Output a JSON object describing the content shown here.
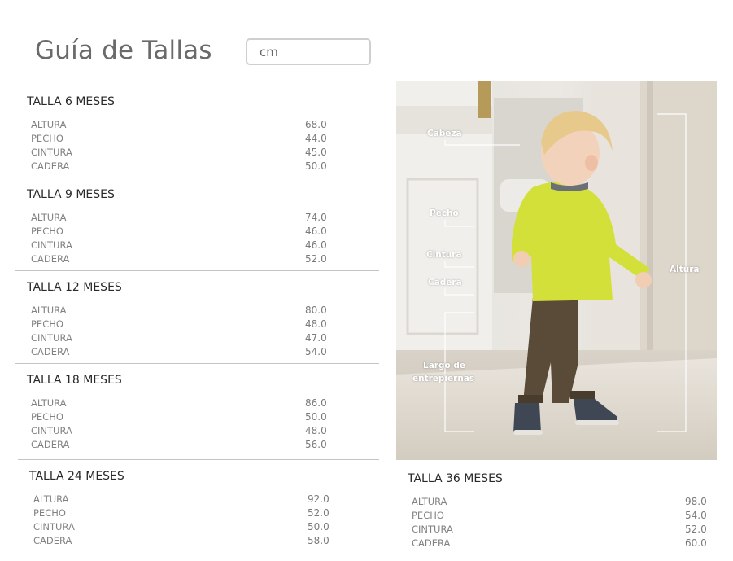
{
  "header": {
    "title": "Guía de Tallas",
    "unit_value": "cm"
  },
  "sizes": [
    {
      "title": "TALLA 6 MESES",
      "rows": [
        {
          "label": "ALTURA",
          "value": "68.0"
        },
        {
          "label": "PECHO",
          "value": "44.0"
        },
        {
          "label": "CINTURA",
          "value": "45.0"
        },
        {
          "label": "CADERA",
          "value": "50.0"
        }
      ]
    },
    {
      "title": "TALLA 9 MESES",
      "rows": [
        {
          "label": "ALTURA",
          "value": "74.0"
        },
        {
          "label": "PECHO",
          "value": "46.0"
        },
        {
          "label": "CINTURA",
          "value": "46.0"
        },
        {
          "label": "CADERA",
          "value": "52.0"
        }
      ]
    },
    {
      "title": "TALLA 12 MESES",
      "rows": [
        {
          "label": "ALTURA",
          "value": "80.0"
        },
        {
          "label": "PECHO",
          "value": "48.0"
        },
        {
          "label": "CINTURA",
          "value": "47.0"
        },
        {
          "label": "CADERA",
          "value": "54.0"
        }
      ]
    },
    {
      "title": "TALLA 18 MESES",
      "rows": [
        {
          "label": "ALTURA",
          "value": "86.0"
        },
        {
          "label": "PECHO",
          "value": "50.0"
        },
        {
          "label": "CINTURA",
          "value": "48.0"
        },
        {
          "label": "CADERA",
          "value": "56.0"
        }
      ]
    },
    {
      "title": "TALLA 24 MESES",
      "rows": [
        {
          "label": "ALTURA",
          "value": "92.0"
        },
        {
          "label": "PECHO",
          "value": "52.0"
        },
        {
          "label": "CINTURA",
          "value": "50.0"
        },
        {
          "label": "CADERA",
          "value": "58.0"
        }
      ]
    },
    {
      "title": "TALLA 36 MESES",
      "rows": [
        {
          "label": "ALTURA",
          "value": "98.0"
        },
        {
          "label": "PECHO",
          "value": "54.0"
        },
        {
          "label": "CINTURA",
          "value": "52.0"
        },
        {
          "label": "CADERA",
          "value": "60.0"
        }
      ]
    }
  ],
  "photo": {
    "labels": {
      "cabeza": "Cabeza",
      "pecho": "Pecho",
      "cintura": "Cintura",
      "cadera": "Cadera",
      "largo_line1": "Largo de",
      "largo_line2": "entrepiernas",
      "altura": "Altura"
    },
    "sweater_color": "#d4e03a",
    "trousers_color": "#5a4a38"
  }
}
